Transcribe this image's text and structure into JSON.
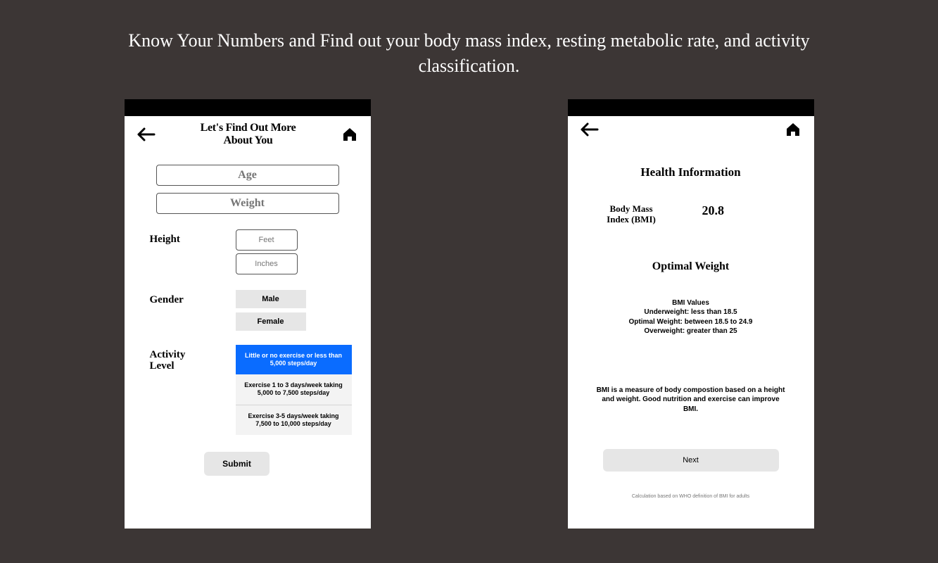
{
  "header": {
    "title": "Know Your Numbers and Find out your body mass index, resting metabolic rate,  and activity classification."
  },
  "phone1": {
    "title_line1": "Let's Find Out More",
    "title_line2": "About You",
    "age_placeholder": "Age",
    "weight_placeholder": "Weight",
    "height_label": "Height",
    "feet_placeholder": "Feet",
    "inches_placeholder": "Inches",
    "gender_label": "Gender",
    "male": "Male",
    "female": "Female",
    "activity_label_line1": "Activity",
    "activity_label_line2": "Level",
    "activity_options": [
      "Little or no exercise or less than 5,000 steps/day",
      "Exercise 1 to 3 days/week taking 5,000 to 7,500 steps/day",
      "Exercise 3-5 days/week taking 7,500 to 10,000 steps/day"
    ],
    "submit": "Submit"
  },
  "phone2": {
    "title": "Health Information",
    "bmi_label_line1": "Body Mass",
    "bmi_label_line2": "Index (BMI)",
    "bmi_value": "20.8",
    "optimal": "Optimal Weight",
    "values_heading": "BMI Values",
    "underweight": "Underweight:  less than 18.5",
    "optimal_range": "Optimal Weight:  between 18.5 to 24.9",
    "overweight": "Overweight: greater than 25",
    "description": "BMI is a measure of body compostion based on a height and weight. Good nutrition and exercise can improve BMI.",
    "next": "Next",
    "footnote": "Calculation based on WHO definition of BMI for adults"
  }
}
